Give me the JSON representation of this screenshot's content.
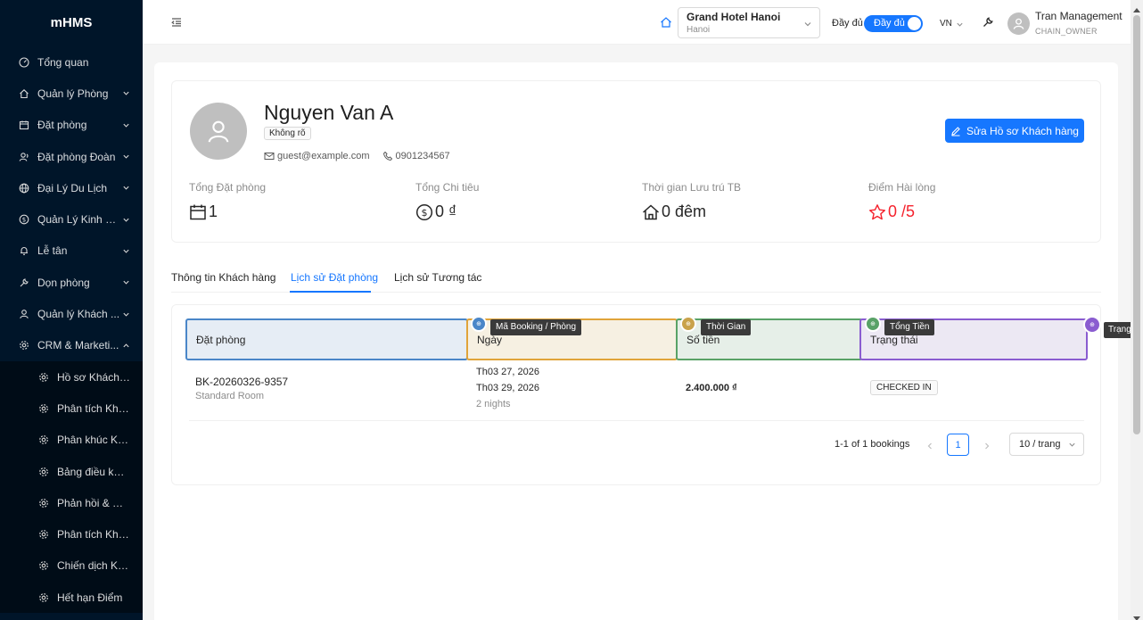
{
  "app": {
    "name": "mHMS"
  },
  "sidebar": {
    "items": [
      {
        "label": "Tổng quan",
        "has_arrow": false
      },
      {
        "label": "Quản lý Phòng",
        "has_arrow": true
      },
      {
        "label": "Đặt phòng",
        "has_arrow": true
      },
      {
        "label": "Đặt phòng Đoàn",
        "has_arrow": true
      },
      {
        "label": "Đại Lý Du Lịch",
        "has_arrow": true
      },
      {
        "label": "Quản Lý Kinh D...",
        "has_arrow": true
      },
      {
        "label": "Lễ tân",
        "has_arrow": true
      },
      {
        "label": "Dọn phòng",
        "has_arrow": true
      },
      {
        "label": "Quản lý Khách ...",
        "has_arrow": true
      },
      {
        "label": "CRM & Marketi...",
        "has_arrow": true
      }
    ],
    "crm_submenu": [
      {
        "label": "Hồ sơ Khách h..."
      },
      {
        "label": "Phân tích Khác..."
      },
      {
        "label": "Phân khúc Khá..."
      },
      {
        "label": "Bảng điều khiể..."
      },
      {
        "label": "Phản hồi & NPS"
      },
      {
        "label": "Phân tích Khác..."
      },
      {
        "label": "Chiến dịch Khá..."
      },
      {
        "label": "Hết hạn Điểm"
      }
    ]
  },
  "header": {
    "hotel_name": "Grand Hotel Hanoi",
    "hotel_city": "Hanoi",
    "mode_label": "Đầy đủ",
    "toggle_label": "Đầy đủ",
    "language": "VN",
    "user_name": "Tran Management",
    "user_role": "CHAIN_OWNER"
  },
  "profile": {
    "name": "Nguyen Van A",
    "gender": "Không rõ",
    "email": "guest@example.com",
    "phone": "0901234567",
    "edit_button": "Sửa Hồ sơ Khách hàng",
    "stats": [
      {
        "label": "Tổng Đặt phòng",
        "value": "1"
      },
      {
        "label": "Tổng Chi tiêu",
        "value": "0 ₫"
      },
      {
        "label": "Thời gian Lưu trú TB",
        "value": "0 đêm"
      },
      {
        "label": "Điểm Hài lòng",
        "value": "0 /5"
      }
    ]
  },
  "tabs": [
    {
      "label": "Thông tin Khách hàng",
      "active": false
    },
    {
      "label": "Lịch sử Đặt phòng",
      "active": true
    },
    {
      "label": "Lịch sử Tương tác",
      "active": false
    }
  ],
  "table": {
    "columns": [
      "Đặt phòng",
      "Ngày",
      "Số tiền",
      "Trạng thái"
    ],
    "overlay_badges": [
      "Mã Booking / Phòng",
      "Thời Gian",
      "Tổng Tiền",
      "Trạng"
    ],
    "rows": [
      {
        "booking_code": "BK-20260326-9357",
        "room_type": "Standard Room",
        "check_in": "Th03 27, 2026",
        "check_out": "Th03 29, 2026",
        "nights": "2 nights",
        "amount": "2.400.000 ₫",
        "status": "CHECKED IN"
      }
    ],
    "pagination": {
      "summary": "1-1 of 1 bookings",
      "current_page": "1",
      "page_size": "10 / trang"
    }
  },
  "colors": {
    "primary": "#1677ff",
    "sidebar_bg": "#001529",
    "col1": "#4a86c8",
    "col2": "#e0a43a",
    "col3": "#59a267",
    "col4": "#8a5cd0",
    "rating": "#f5222d"
  }
}
